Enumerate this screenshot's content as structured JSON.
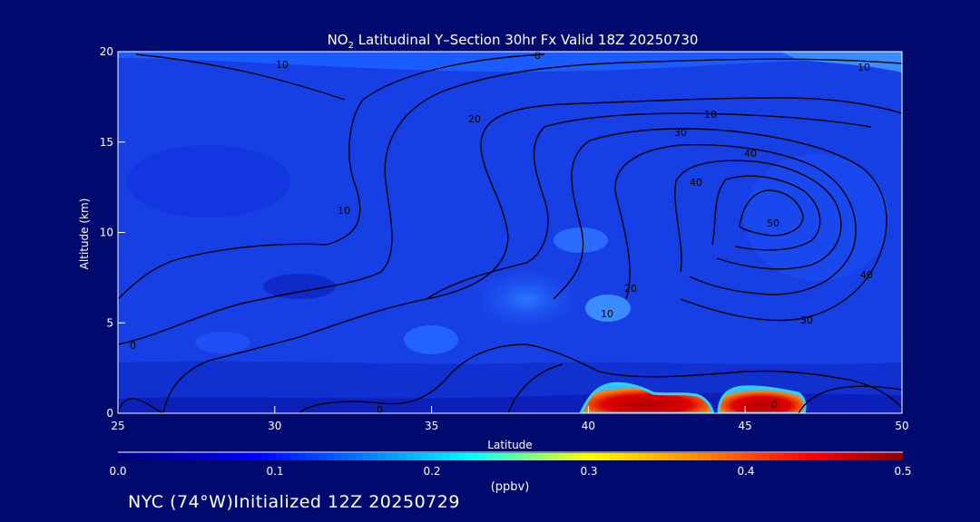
{
  "chart_data": {
    "type": "heatmap",
    "title": "NO₂ Latitudinal Y–Section 30hr  Fx Valid 18Z 20250730",
    "xlabel": "Latitude",
    "ylabel": "Altitude (km)",
    "xlim": [
      25,
      50
    ],
    "ylim": [
      0,
      20
    ],
    "x_ticks": [
      "25",
      "30",
      "35",
      "40",
      "45",
      "50"
    ],
    "y_ticks": [
      "0",
      "5",
      "10",
      "15",
      "20"
    ],
    "colorbar": {
      "unit": "(ppbv)",
      "range": [
        0.0,
        0.5
      ],
      "ticks": [
        "0.0",
        "0.1",
        "0.2",
        "0.3",
        "0.4",
        "0.5"
      ],
      "colormap": [
        "#00008c",
        "#0000ff",
        "#00aaff",
        "#00ffff",
        "#ffff00",
        "#ff7f00",
        "#ff0000",
        "#8c0000"
      ]
    },
    "no2_hotspots": [
      {
        "lat_range": [
          39.8,
          42.8
        ],
        "alt_range": [
          0,
          1.5
        ],
        "value": 0.48
      },
      {
        "lat_range": [
          43.5,
          46.8
        ],
        "alt_range": [
          0,
          1.3
        ],
        "value": 0.47
      }
    ],
    "contours": {
      "jet_center": {
        "lat": 46,
        "alt": 11.5
      },
      "levels": [
        "0",
        "10",
        "20",
        "30",
        "40",
        "50"
      ],
      "labels_shown": [
        "10",
        "0",
        "10",
        "20",
        "30",
        "40",
        "40",
        "50",
        "40",
        "30",
        "20",
        "10",
        "0",
        "10",
        "0",
        "0",
        "10",
        "20"
      ]
    }
  },
  "footer": "NYC (74°W)Initialized 12Z 20250729"
}
